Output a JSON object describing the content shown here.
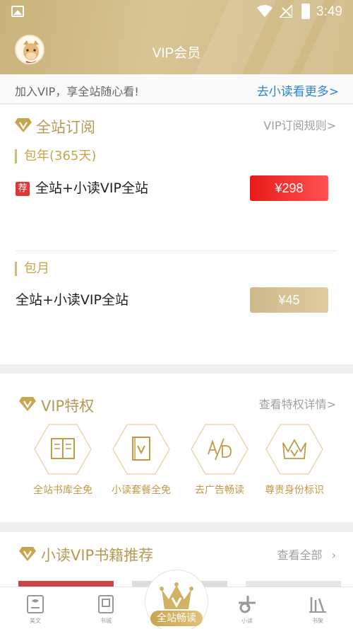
{
  "status_bar": {
    "time": "3:49"
  },
  "header": {
    "title": "VIP会员"
  },
  "notice": {
    "text": "加入VIP，享全站随心看!",
    "link": "去小读看更多>"
  },
  "subscription": {
    "title": "全站订阅",
    "rules_link": "VIP订阅规则>",
    "plans": [
      {
        "label": "包年(365天)",
        "tag": "荐",
        "name": "全站+小读VIP全站",
        "price": "¥298"
      },
      {
        "label": "包月",
        "name": "全站+小读VIP全站",
        "price": "¥45"
      }
    ]
  },
  "privileges": {
    "title": "VIP特权",
    "link": "查看特权详情>",
    "items": [
      {
        "label": "全站书库全免",
        "icon": "open-book-icon"
      },
      {
        "label": "小读套餐全免",
        "icon": "v-book-icon"
      },
      {
        "label": "去广告畅读",
        "icon": "ad-free-icon"
      },
      {
        "label": "尊贵身份标识",
        "icon": "crown-icon"
      }
    ]
  },
  "recommend": {
    "title": "小读VIP书籍推荐",
    "link": "查看全部"
  },
  "tabbar": {
    "tabs": [
      {
        "label": "美文",
        "icon": "article-icon"
      },
      {
        "label": "书城",
        "icon": "bookstore-icon"
      },
      {
        "label": "全站畅读",
        "icon": "vip-crown-icon"
      },
      {
        "label": "小读",
        "icon": "xiaodu-icon"
      },
      {
        "label": "书架",
        "icon": "bookshelf-icon"
      }
    ]
  },
  "colors": {
    "gold": "#c9a54a",
    "link_blue": "#2b84d6",
    "price_red": "#e91a1a"
  }
}
